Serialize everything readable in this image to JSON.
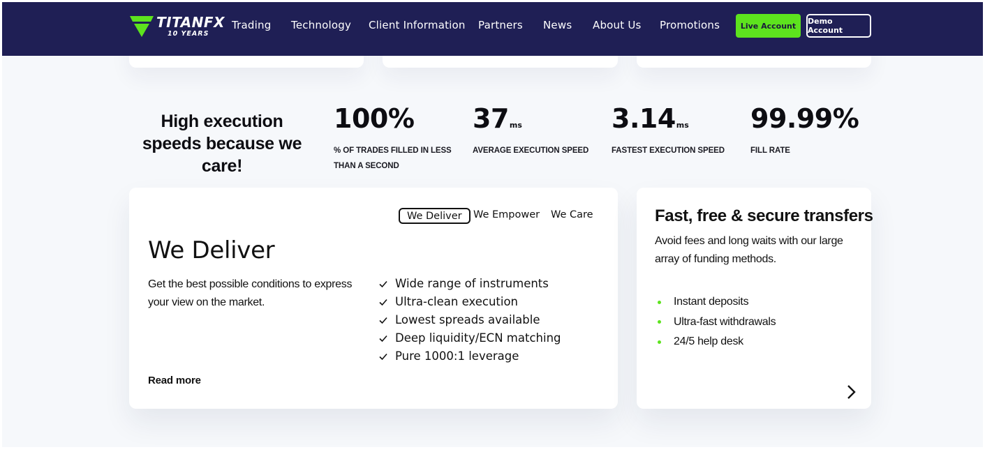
{
  "brand": {
    "name": "TITANFX",
    "sub": "10 YEARS",
    "accent": "#5de31e",
    "navy": "#1f1f55"
  },
  "nav": {
    "items": [
      "Trading",
      "Technology",
      "Client Information",
      "Partners",
      "News",
      "About Us",
      "Promotions"
    ],
    "live_account": "Live Account",
    "demo_account": "Demo Account"
  },
  "stats": {
    "heading": "High execution speeds because we care!",
    "items": [
      {
        "value": "100%",
        "unit": "",
        "label": "% of trades filled in less than a second"
      },
      {
        "value": "37",
        "unit": "ms",
        "label": "Average execution speed"
      },
      {
        "value": "3.14",
        "unit": "ms",
        "label": "Fastest execution speed"
      },
      {
        "value": "99.99%",
        "unit": "",
        "label": "Fill rate"
      }
    ]
  },
  "deliver_card": {
    "tabs": [
      "We Deliver",
      "We Empower",
      "We Care"
    ],
    "active_tab": "We Deliver",
    "title": "We Deliver",
    "description": "Get the best possible conditions to express your view on the market.",
    "features": [
      "Wide range of instruments",
      "Ultra-clean execution",
      "Lowest spreads available",
      "Deep liquidity/ECN matching",
      "Pure 1000:1 leverage"
    ],
    "read_more": "Read more"
  },
  "transfer_card": {
    "title": "Fast, free & secure transfers",
    "description": "Avoid fees and long waits with our large array of funding methods.",
    "features": [
      "Instant deposits",
      "Ultra-fast withdrawals",
      "24/5 help desk"
    ],
    "next_icon": "chevron-right-icon"
  }
}
